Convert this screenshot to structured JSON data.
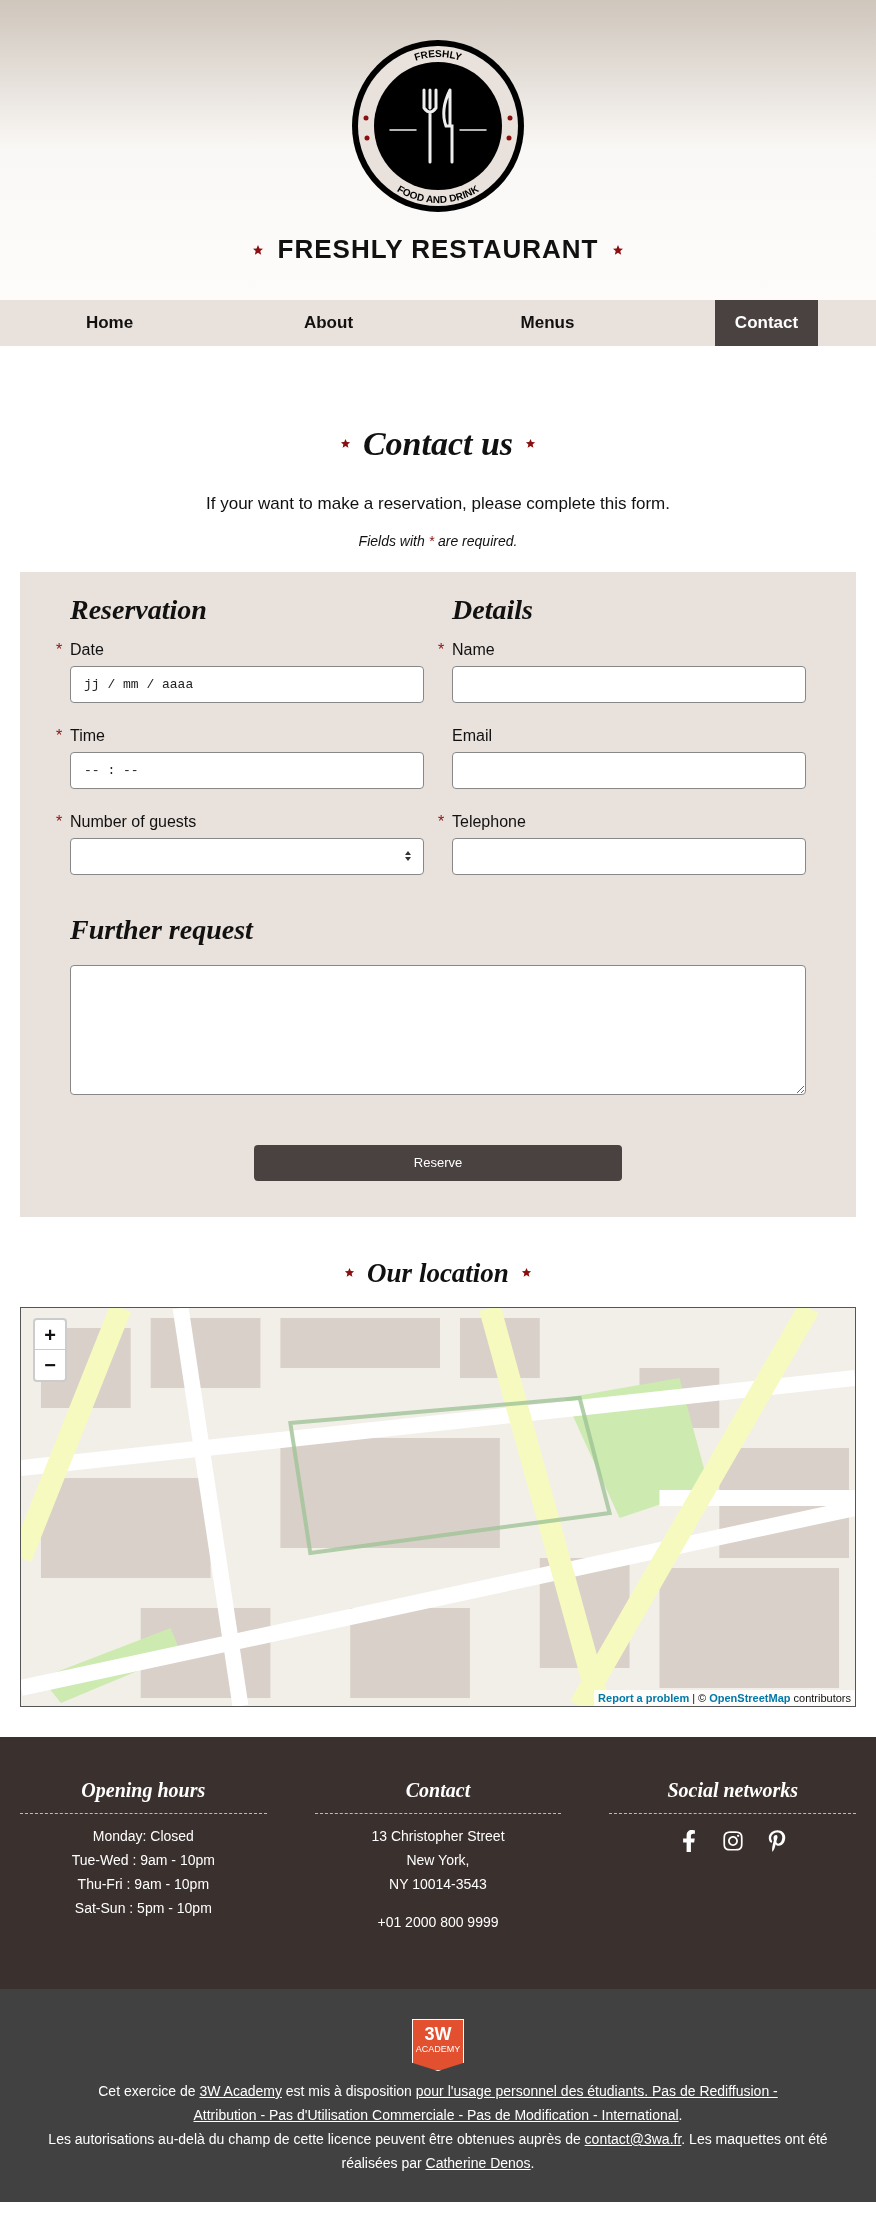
{
  "logo": {
    "top_text": "FRESHLY",
    "bottom_text": "FOOD AND DRINK"
  },
  "site_title": "FRESHLY RESTAURANT",
  "nav": [
    {
      "label": "Home",
      "selected": false
    },
    {
      "label": "About",
      "selected": false
    },
    {
      "label": "Menus",
      "selected": false
    },
    {
      "label": "Contact",
      "selected": true
    }
  ],
  "page_title": "Contact us",
  "intro": "If your want to make a reservation, please complete this form.",
  "required_note": {
    "before": "Fields with",
    "mark": "*",
    "after": "are required."
  },
  "form": {
    "columns": [
      {
        "title": "Reservation",
        "fields": [
          {
            "label": "Date",
            "required": true,
            "kind": "date",
            "placeholder": "jj / mm / aaaa"
          },
          {
            "label": "Time",
            "required": true,
            "kind": "time",
            "placeholder": "-- : --"
          },
          {
            "label": "Number of guests",
            "required": true,
            "kind": "number"
          }
        ]
      },
      {
        "title": "Details",
        "fields": [
          {
            "label": "Name",
            "required": true,
            "kind": "text"
          },
          {
            "label": "Email",
            "required": false,
            "kind": "text"
          },
          {
            "label": "Telephone",
            "required": true,
            "kind": "text"
          }
        ]
      }
    ],
    "request_title": "Further request",
    "submit": "Reserve"
  },
  "location": {
    "title": "Our location",
    "zoom_in": "+",
    "zoom_out": "−",
    "report_link": "Report a problem",
    "attribution_separator": "| ©",
    "attribution_link": "OpenStreetMap",
    "attribution_suffix": "contributors"
  },
  "footer": {
    "columns": [
      {
        "kind": "hours",
        "title": "Opening hours",
        "lines": [
          "Monday: Closed",
          "Tue-Wed : 9am - 10pm",
          "Thu-Fri : 9am - 10pm",
          "Sat-Sun : 5pm - 10pm"
        ]
      },
      {
        "kind": "contact",
        "title": "Contact",
        "lines": [
          "13 Christopher Street",
          "New York,",
          "NY 10014-3543"
        ],
        "phone": "+01 2000 800 9999"
      },
      {
        "kind": "social",
        "title": "Social networks",
        "networks": [
          {
            "kind": "facebook"
          },
          {
            "kind": "instagram"
          },
          {
            "kind": "pinterest"
          }
        ]
      }
    ]
  },
  "credits": {
    "badge_top": "3W",
    "badge_bottom": "ACADEMY",
    "paragraphs": [
      [
        {
          "kind": "text",
          "text": "Cet exercice de"
        },
        {
          "kind": "link",
          "text": "3W Academy"
        },
        {
          "kind": "text",
          "text": "est mis à disposition"
        },
        {
          "kind": "link",
          "text": "pour l'usage personnel des étudiants. Pas de Rediffusion -"
        },
        {
          "kind": "link",
          "text": "Attribution - Pas d'Utilisation Commerciale - Pas de Modification - International"
        },
        {
          "kind": "text",
          "text": "."
        }
      ],
      [
        {
          "kind": "text",
          "text": "Les autorisations au-delà du champ de cette licence peuvent être obtenues auprès de"
        },
        {
          "kind": "link",
          "text": "contact@3wa.fr"
        },
        {
          "kind": "text",
          "text": ". Les maquettes ont été réalisées par"
        },
        {
          "kind": "link",
          "text": "Catherine Denos"
        },
        {
          "kind": "text",
          "text": "."
        }
      ]
    ]
  }
}
